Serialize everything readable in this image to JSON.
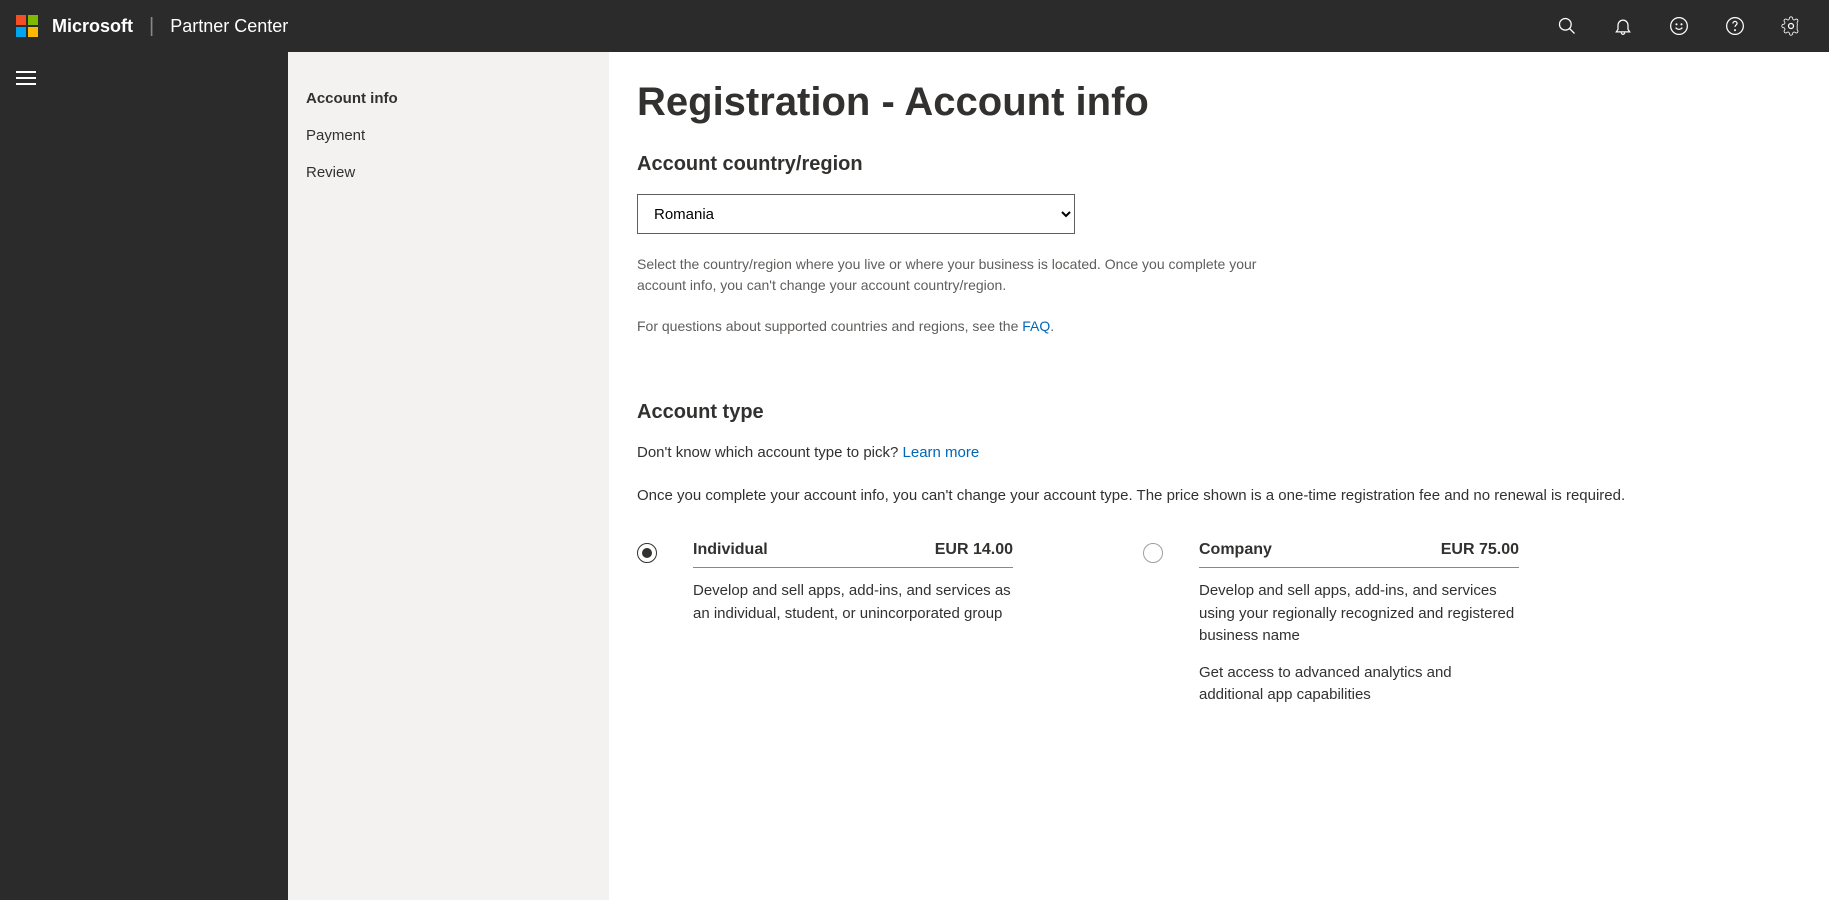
{
  "header": {
    "brand": "Microsoft",
    "product": "Partner Center"
  },
  "sidenav": {
    "items": [
      {
        "label": "Account info"
      },
      {
        "label": "Payment"
      },
      {
        "label": "Review"
      }
    ]
  },
  "page": {
    "title": "Registration - Account info",
    "country_section_title": "Account country/region",
    "country_value": "Romania",
    "country_help": "Select the country/region where you live or where your business is located. Once you complete your account info, you can't change your account country/region.",
    "faq_prefix": "For questions about supported countries and regions, see the ",
    "faq_link": "FAQ",
    "faq_suffix": ".",
    "type_section_title": "Account type",
    "type_prompt_prefix": "Don't know which account type to pick? ",
    "type_prompt_link": "Learn more",
    "type_note": "Once you complete your account info, you can't change your account type. The price shown is a one-time registration fee and no renewal is required.",
    "options": [
      {
        "name": "Individual",
        "price": "EUR 14.00",
        "desc1": "Develop and sell apps, add-ins, and services as an individual, student, or unincorporated group",
        "desc2": "",
        "selected": true
      },
      {
        "name": "Company",
        "price": "EUR 75.00",
        "desc1": "Develop and sell apps, add-ins, and services using your regionally recognized and registered business name",
        "desc2": "Get access to advanced analytics and additional app capabilities",
        "selected": false
      }
    ]
  }
}
